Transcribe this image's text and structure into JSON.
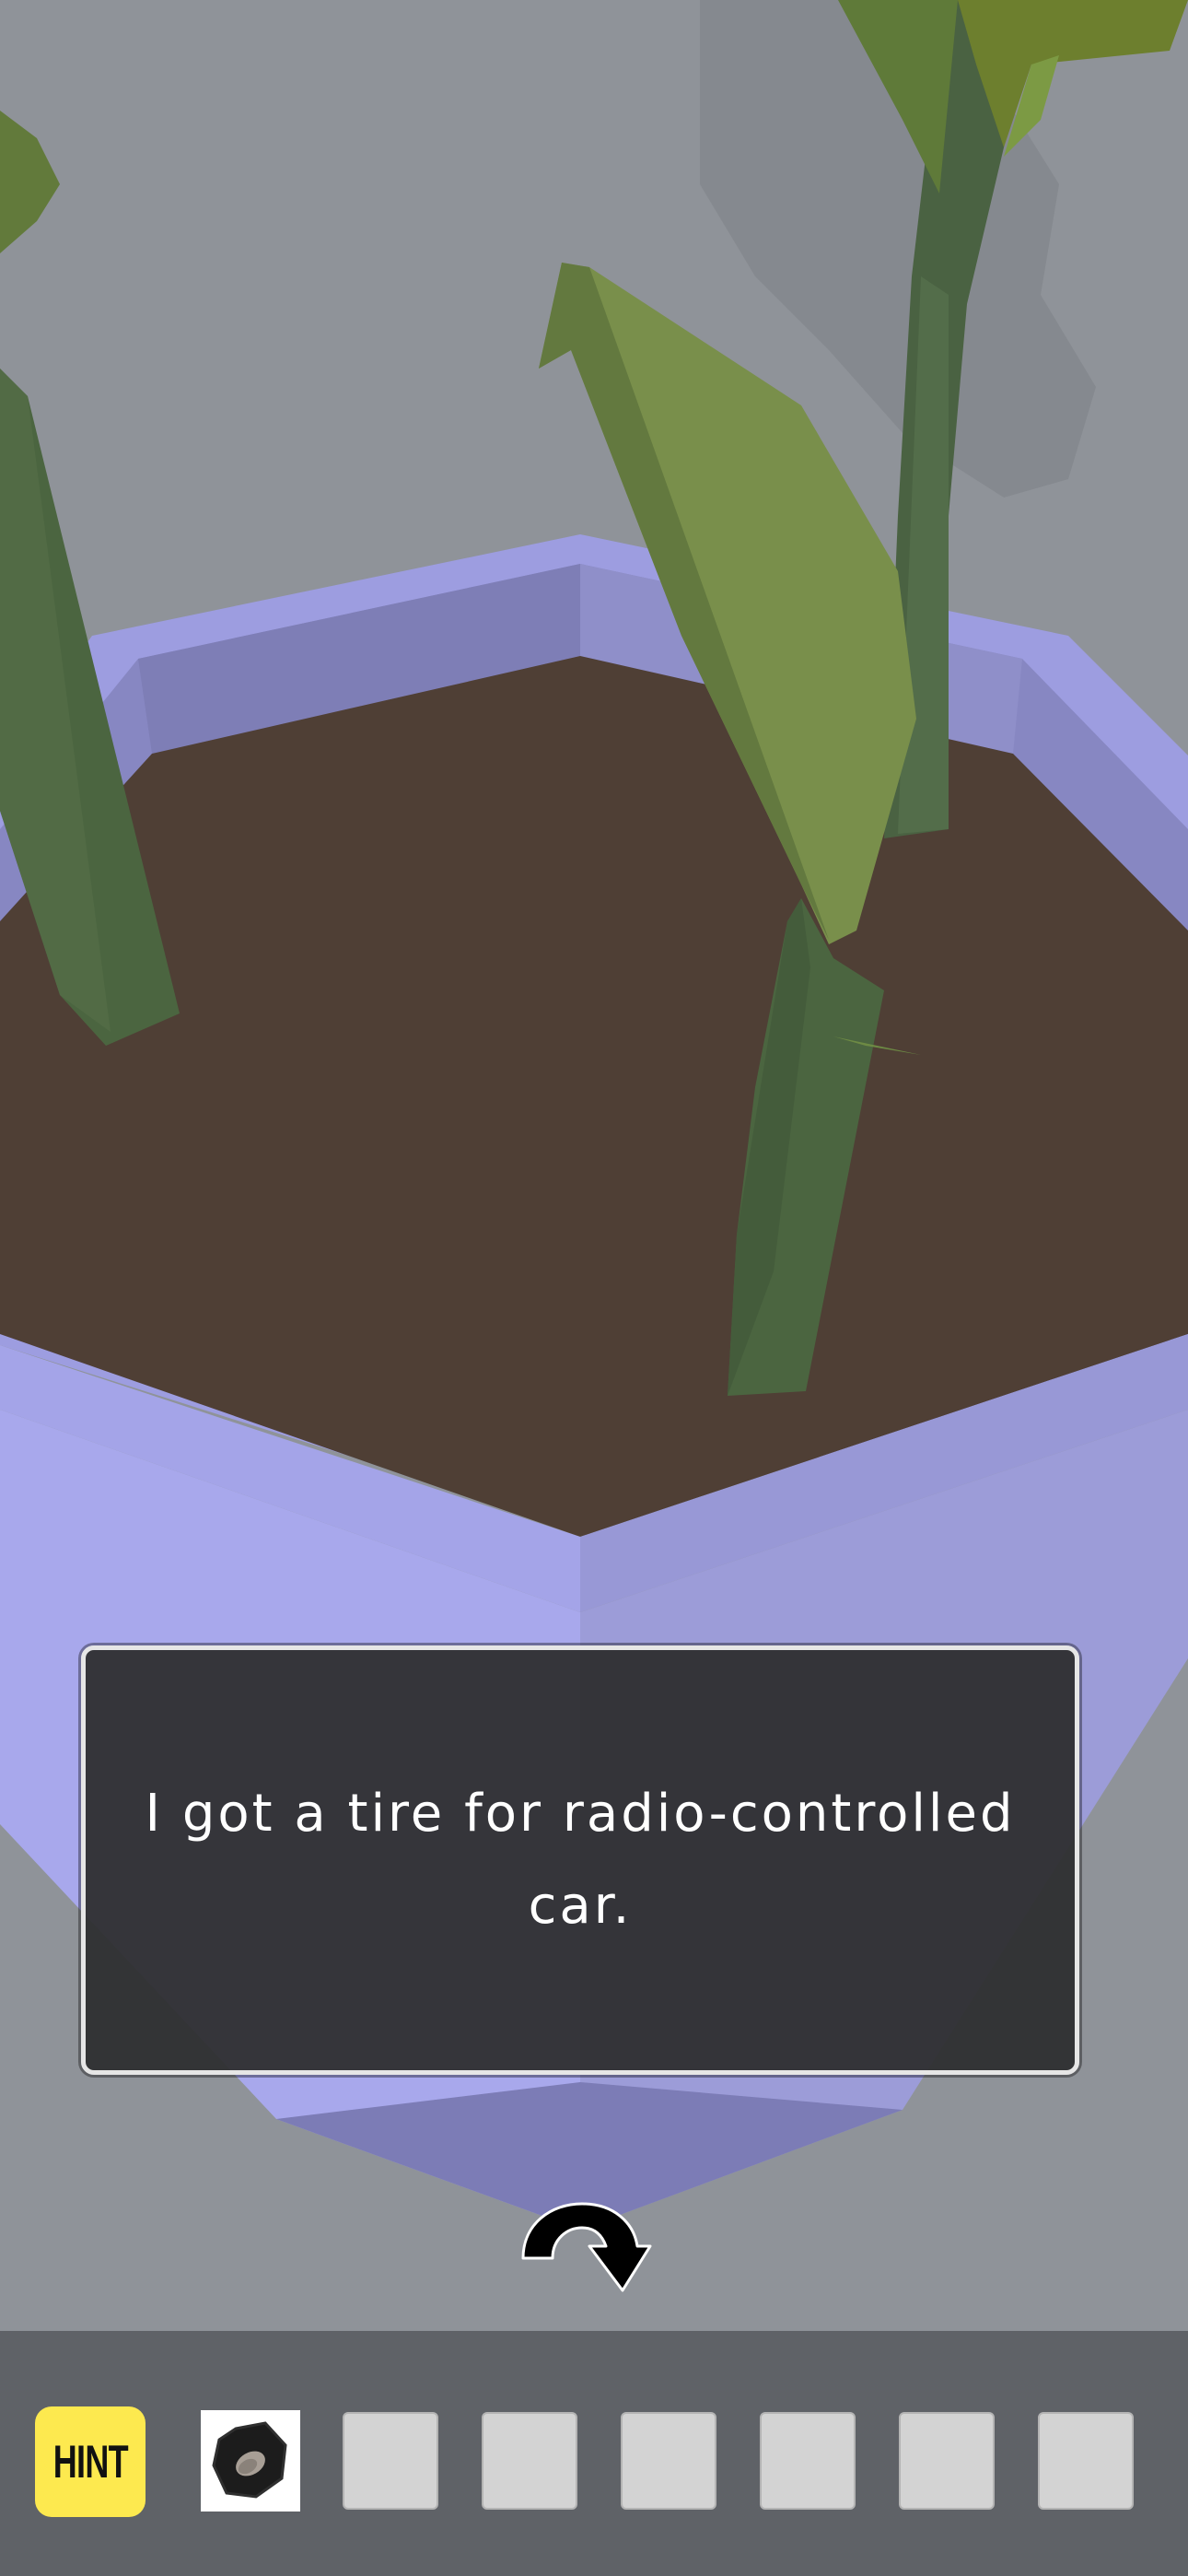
{
  "dialog": {
    "message": "I got a tire for radio-controlled car."
  },
  "controls": {
    "turn_icon": "rotate-arrow-icon"
  },
  "inventory": {
    "hint_label": "HINT",
    "slots": [
      {
        "item": "rc-car-tire",
        "icon": "tire-icon",
        "selected": true
      },
      {
        "item": "",
        "selected": false
      },
      {
        "item": "",
        "selected": false
      },
      {
        "item": "",
        "selected": false
      },
      {
        "item": "",
        "selected": false
      },
      {
        "item": "",
        "selected": false
      },
      {
        "item": "",
        "selected": false
      }
    ]
  },
  "colors": {
    "soil": "#4f3f35",
    "pot": "#9a9ad8",
    "leaf": "#768f4c",
    "stem": "#4b6540",
    "hint_button": "#fde94f",
    "inventory_bar": "#5f6267"
  }
}
